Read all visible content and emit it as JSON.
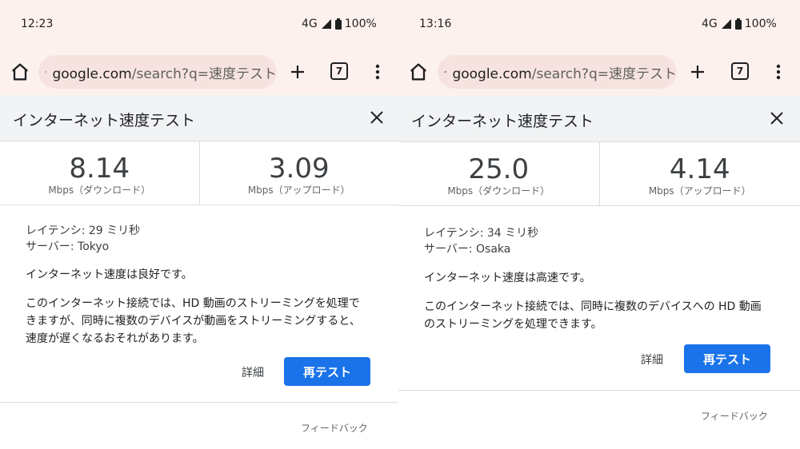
{
  "left": {
    "status": {
      "time": "12:23",
      "network": "4G",
      "battery": "100%"
    },
    "toolbar": {
      "url_host": "google.com",
      "url_path": "/search?q=速度テスト",
      "tab_count": "7"
    },
    "widget": {
      "title": "インターネット速度テスト",
      "download": {
        "value": "8.14",
        "unit": "Mbps（ダウンロード）"
      },
      "upload": {
        "value": "3.09",
        "unit": "Mbps（アップロード）"
      },
      "latency": "レイテンシ: 29 ミリ秒",
      "server": "サーバー: Tokyo",
      "verdict": "インターネット速度は良好です。",
      "description_lines": [
        "このインターネット接続では、HD 動画のストリーミングを処理で",
        "きますが、同時に複数のデバイスが動画をストリーミングすると、",
        "速度が遅くなるおそれがあります。"
      ],
      "details_label": "詳細",
      "retest_label": "再テスト",
      "feedback_label": "フィードバック"
    }
  },
  "right": {
    "status": {
      "time": "13:16",
      "network": "4G",
      "battery": "100%"
    },
    "toolbar": {
      "url_host": "google.com",
      "url_path": "/search?q=速度テスト",
      "tab_count": "7"
    },
    "widget": {
      "title": "インターネット速度テスト",
      "download": {
        "value": "25.0",
        "unit": "Mbps（ダウンロード）"
      },
      "upload": {
        "value": "4.14",
        "unit": "Mbps（アップロード）"
      },
      "latency": "レイテンシ: 34 ミリ秒",
      "server": "サーバー: Osaka",
      "verdict": "インターネット速度は高速です。",
      "description_lines": [
        "このインターネット接続では、同時に複数のデバイスへの HD 動画",
        "のストリーミングを処理できます。"
      ],
      "details_label": "詳細",
      "retest_label": "再テスト",
      "feedback_label": "フィードバック"
    }
  },
  "colors": {
    "accent": "#1a73e8",
    "chrome_bg": "#fdf1ee",
    "urlbar_bg": "#f6e3df"
  }
}
